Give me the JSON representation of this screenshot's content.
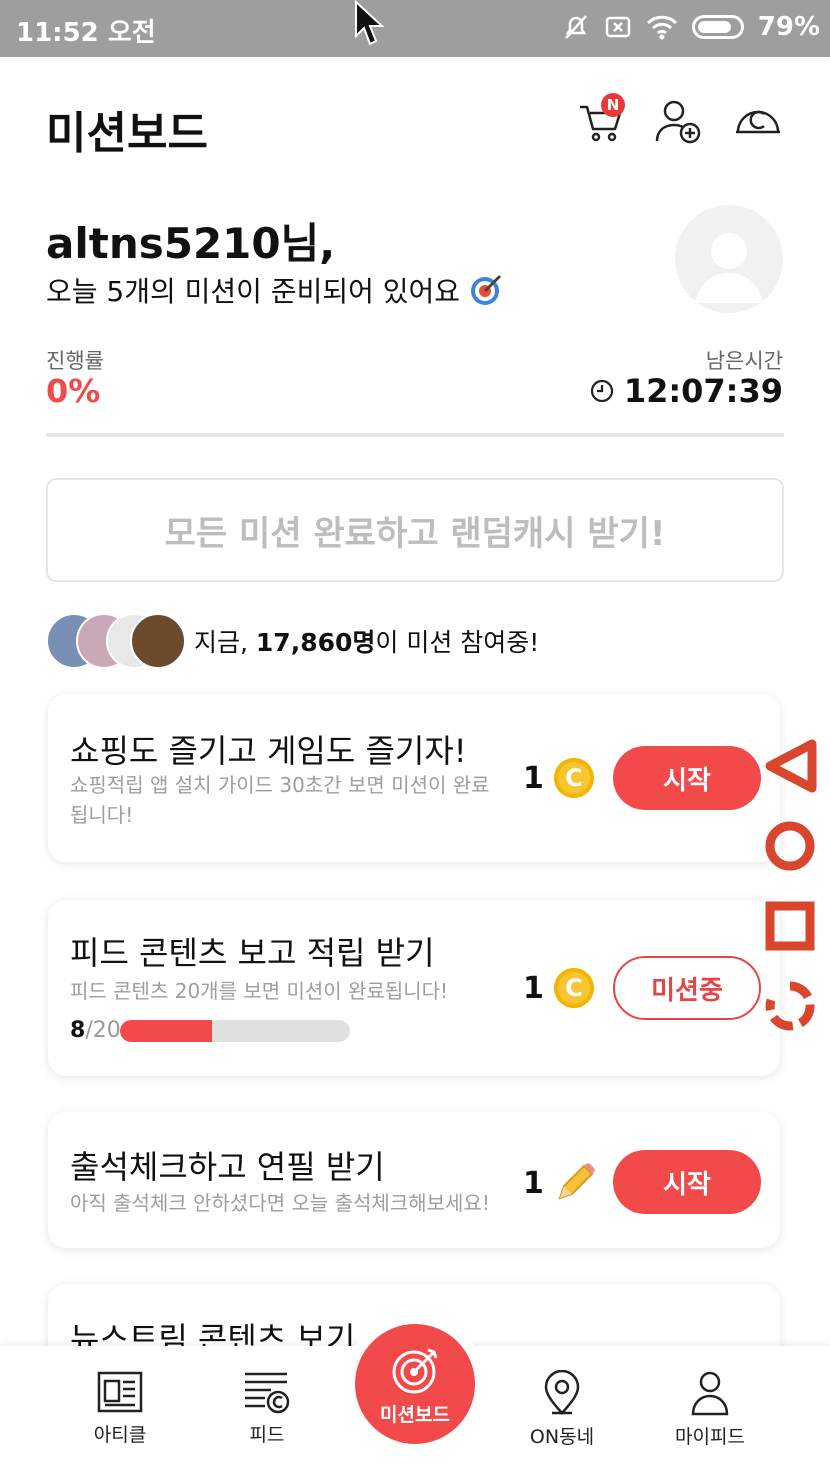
{
  "status_bar": {
    "time": "11:52 오전",
    "battery": "79%"
  },
  "header": {
    "title": "미션보드",
    "cart_badge": "N"
  },
  "greeting": {
    "name": "altns5210님,",
    "subtitle": "오늘 5개의 미션이 준비되어 있어요"
  },
  "progress": {
    "label": "진행률",
    "value": "0%",
    "remaining_label": "남은시간",
    "remaining_value": "12:07:39"
  },
  "reward_banner": "모든 미션 완료하고 랜덤캐시 받기!",
  "participants": {
    "prefix": "지금, ",
    "count": "17,860명",
    "suffix": "이 미션 참여중!"
  },
  "missions": [
    {
      "title": "쇼핑도 즐기고 게임도 즐기자!",
      "desc": "쇼핑적립 앱 설치 가이드 30초간 보면 미션이 완료됩니다!",
      "reward": "1",
      "reward_icon": "coin-icon",
      "button": "시작"
    },
    {
      "title": "피드 콘텐츠 보고 적립 받기",
      "desc": "피드 콘텐츠 20개를 보면 미션이 완료됩니다!",
      "reward": "1",
      "reward_icon": "coin-icon",
      "button": "미션중",
      "progress_done": "8",
      "progress_total": "/20",
      "progress_fraction": 0.4
    },
    {
      "title": "출석체크하고 연필 받기",
      "desc": "아직 출석체크 안하셨다면 오늘 출석체크해보세요!",
      "reward": "1",
      "reward_icon": "pencil-icon",
      "button": "시작"
    },
    {
      "title": "뉴스트림 콘텐츠 보기"
    }
  ],
  "nav": [
    {
      "label": "아티클",
      "icon": "article-icon"
    },
    {
      "label": "피드",
      "icon": "feed-icon"
    },
    {
      "label": "미션보드",
      "icon": "target-icon"
    },
    {
      "label": "ON동네",
      "icon": "location-pin-icon"
    },
    {
      "label": "마이피드",
      "icon": "person-icon"
    }
  ],
  "colors": {
    "accent": "#f24a4a",
    "coin": "#f8c533",
    "status_bar": "#9e9e9e"
  }
}
